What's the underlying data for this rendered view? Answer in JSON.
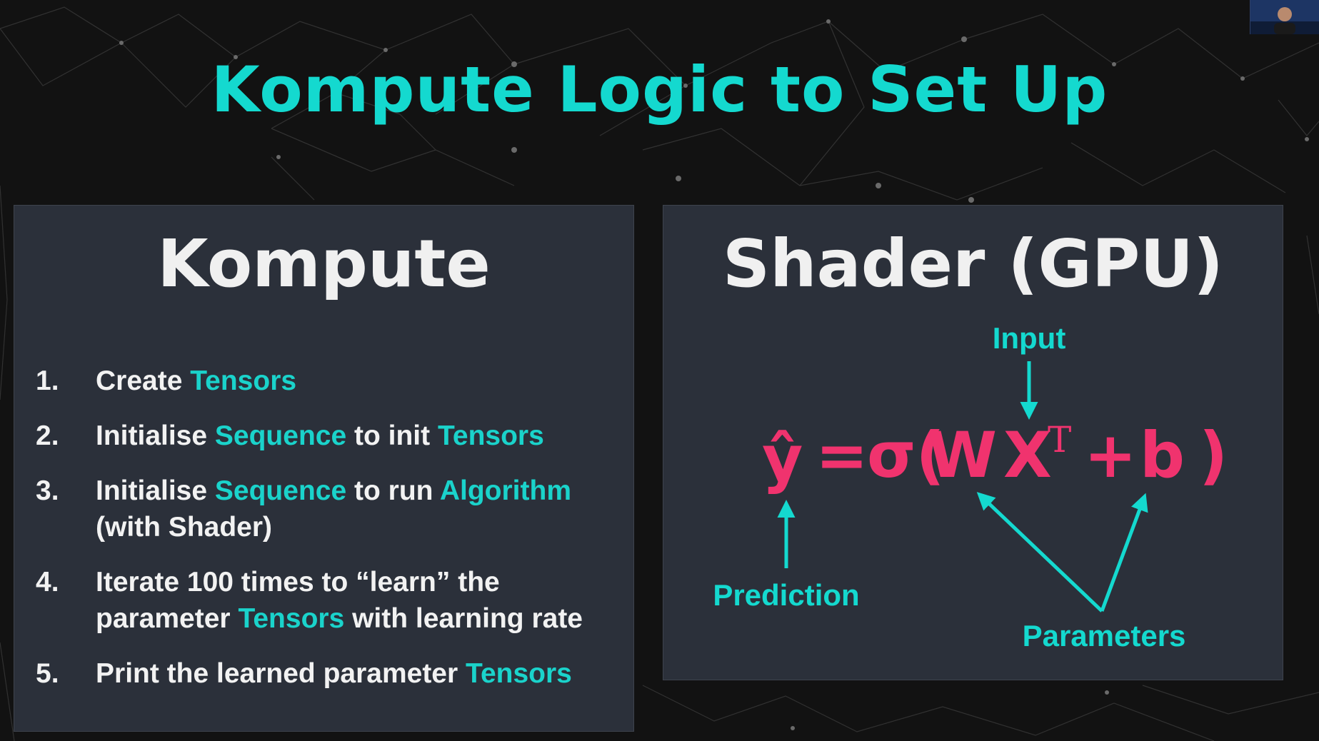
{
  "slide": {
    "title": "Kompute Logic to Set Up"
  },
  "left_panel": {
    "heading": "Kompute",
    "steps": [
      {
        "num": "1.",
        "lines": [
          [
            {
              "t": "Create "
            },
            {
              "t": "Tensors",
              "hl": true
            }
          ]
        ]
      },
      {
        "num": "2.",
        "lines": [
          [
            {
              "t": "Initialise "
            },
            {
              "t": "Sequence",
              "hl": true
            },
            {
              "t": " to init "
            },
            {
              "t": "Tensors",
              "hl": true
            }
          ]
        ]
      },
      {
        "num": "3.",
        "lines": [
          [
            {
              "t": "Initialise "
            },
            {
              "t": "Sequence",
              "hl": true
            },
            {
              "t": " to run "
            },
            {
              "t": "Algorithm",
              "hl": true
            }
          ],
          [
            {
              "t": "(with Shader)"
            }
          ]
        ]
      },
      {
        "num": "4.",
        "lines": [
          [
            {
              "t": "Iterate 100 times to “learn” the"
            }
          ],
          [
            {
              "t": "parameter "
            },
            {
              "t": "Tensors",
              "hl": true
            },
            {
              "t": " with learning rate"
            }
          ]
        ]
      },
      {
        "num": "5.",
        "lines": [
          [
            {
              "t": "Print the learned parameter "
            },
            {
              "t": "Tensors",
              "hl": true
            }
          ]
        ]
      }
    ]
  },
  "right_panel": {
    "heading": "Shader (GPU)",
    "formula": {
      "lhs": "ŷ",
      "equals": "=",
      "sigma": "σ(",
      "w": "W",
      "x": "X",
      "superscript": "T",
      "plus": "+",
      "b": "b",
      "close": ")"
    },
    "labels": {
      "input": "Input",
      "prediction": "Prediction",
      "parameters": "Parameters"
    }
  },
  "colors": {
    "accent_teal": "#14d9cf",
    "formula_pink": "#f0336e",
    "panel_bg": "#2b303a",
    "page_bg": "#121212"
  }
}
